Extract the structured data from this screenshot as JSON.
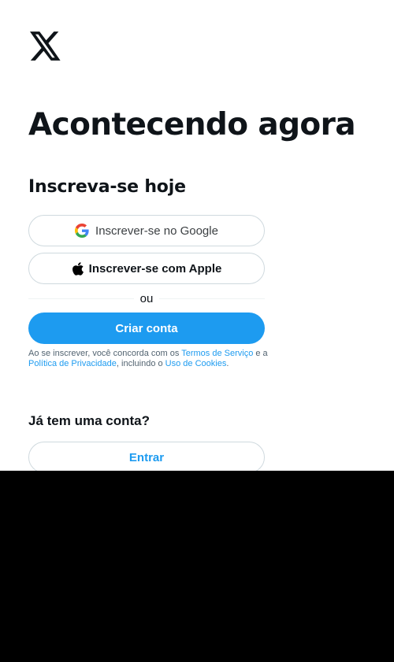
{
  "colors": {
    "accent": "#1d9bf0",
    "text": "#0f1419",
    "muted": "#536471",
    "border": "#cfd9de"
  },
  "logo": {
    "icon": "x-logo-icon"
  },
  "headline": "Acontecendo agora",
  "signup": {
    "title": "Inscreva-se hoje",
    "google_label": "Inscrever-se no Google",
    "apple_label": "Inscrever-se com Apple",
    "divider": "ou",
    "create_label": "Criar conta",
    "terms": {
      "prefix": "Ao se inscrever, você concorda com os ",
      "terms_link": "Termos de Serviço",
      "middle": " e a ",
      "privacy_link": "Política de Privacidade",
      "middle2": ", incluindo o ",
      "cookies_link": "Uso de Cookies",
      "suffix": "."
    }
  },
  "login": {
    "question": "Já tem uma conta?",
    "button_label": "Entrar"
  }
}
